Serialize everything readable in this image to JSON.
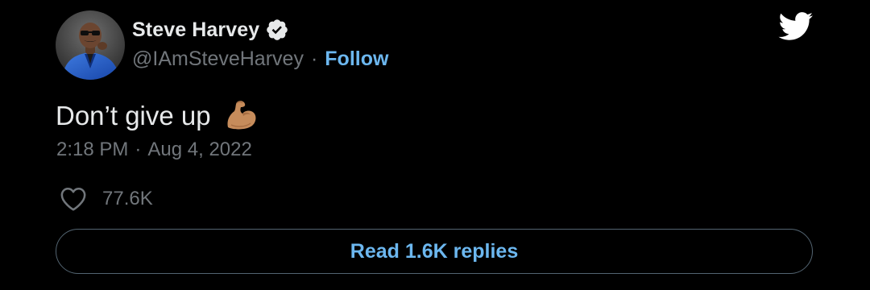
{
  "author": {
    "display_name": "Steve Harvey",
    "handle": "@IAmSteveHarvey",
    "separator": "·",
    "follow_label": "Follow",
    "verified": true,
    "avatar_icon": "avatar-photo"
  },
  "brand": {
    "icon": "twitter-bird-icon",
    "color": "#ffffff"
  },
  "tweet": {
    "text": "Don’t give up",
    "emoji_icon": "flexed-biceps-icon",
    "time": "2:18 PM",
    "date": "Aug 4, 2022",
    "date_separator": "·"
  },
  "engagement": {
    "likes_icon": "heart-icon",
    "likes_count": "77.6K"
  },
  "replies_button": {
    "label": "Read 1.6K replies"
  },
  "colors": {
    "background": "#000000",
    "primary_text": "#e7e9ea",
    "secondary_text": "#71767b",
    "accent": "#6cb7ef",
    "border": "#536471"
  }
}
